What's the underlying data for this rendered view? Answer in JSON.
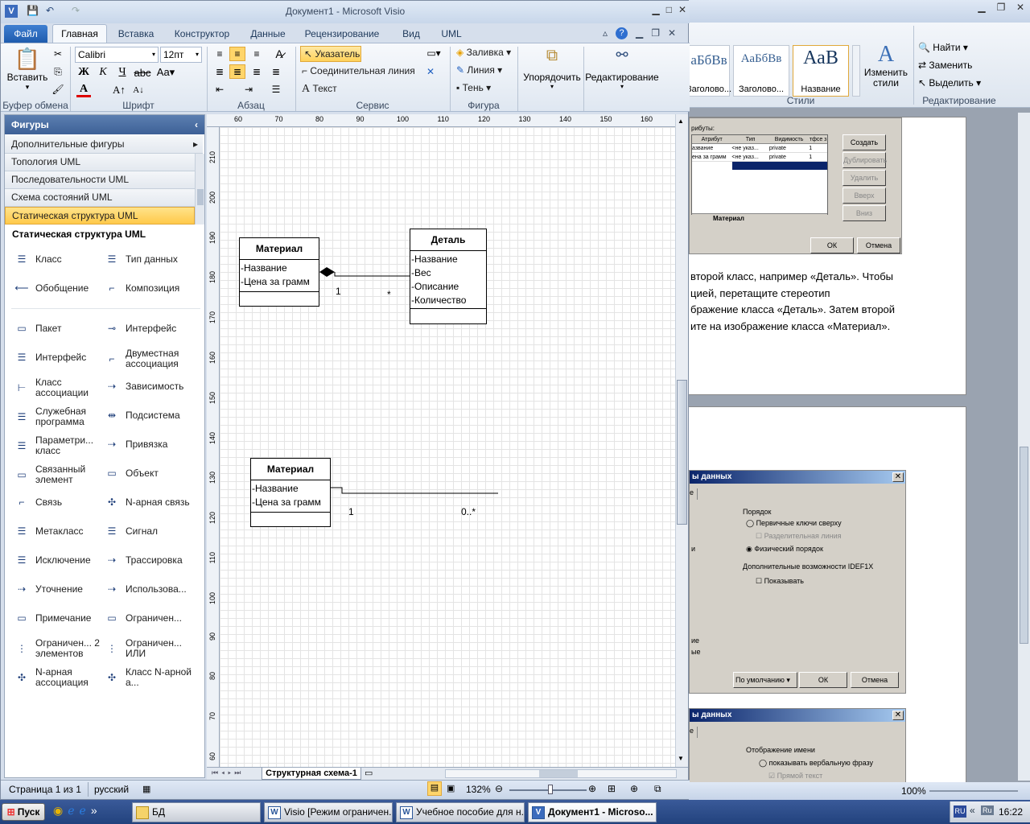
{
  "visio": {
    "title": "Документ1 - Microsoft Visio",
    "tabs": [
      "Файл",
      "Главная",
      "Вставка",
      "Конструктор",
      "Данные",
      "Рецензирование",
      "Вид",
      "UML"
    ],
    "ribbon": {
      "paste": "Вставить",
      "clipboard": "Буфер обмена",
      "font_name": "Calibri",
      "font_size": "12пт",
      "font_group": "Шрифт",
      "paragraph_group": "Абзац",
      "pointer": "Указатель",
      "connector": "Соединительная линия",
      "text": "Текст",
      "service_group": "Сервис",
      "fill": "Заливка",
      "line": "Линия",
      "shadow": "Тень",
      "shape_group": "Фигура",
      "arrange": "Упорядочить",
      "editing": "Редактирование"
    },
    "shapes": {
      "header": "Фигуры",
      "stencils": [
        "Дополнительные фигуры",
        "Топология UML",
        "Последовательности UML",
        "Схема состояний UML",
        "Статическая структура UML"
      ],
      "section_title": "Статическая структура UML",
      "items": [
        [
          "Класс",
          "Тип данных"
        ],
        [
          "Обобщение",
          "Композиция"
        ],
        [
          "Пакет",
          "Интерфейс"
        ],
        [
          "Интерфейс",
          "Двуместная ассоциация"
        ],
        [
          "Класс ассоциации",
          "Зависимость"
        ],
        [
          "Служебная программа",
          "Подсистема"
        ],
        [
          "Параметри... класс",
          "Привязка"
        ],
        [
          "Связанный элемент",
          "Объект"
        ],
        [
          "Связь",
          "N-арная связь"
        ],
        [
          "Метакласс",
          "Сигнал"
        ],
        [
          "Исключение",
          "Трассировка"
        ],
        [
          "Уточнение",
          "Использова..."
        ],
        [
          "Примечание",
          "Ограничен..."
        ],
        [
          "Ограничен... 2 элементов",
          "Ограничен... ИЛИ"
        ],
        [
          "N-арная ассоциация",
          "Класс N-арной а..."
        ]
      ]
    },
    "ruler_h": [
      "60",
      "70",
      "80",
      "90",
      "100",
      "110",
      "120",
      "130",
      "140",
      "150",
      "160"
    ],
    "ruler_v": [
      "210",
      "200",
      "190",
      "180",
      "170",
      "160",
      "150",
      "140",
      "130",
      "120",
      "110",
      "100",
      "90",
      "80",
      "70",
      "60"
    ],
    "diagram": {
      "class1": {
        "name": "Материал",
        "attrs": [
          "-Название",
          "-Цена за грамм"
        ]
      },
      "class2": {
        "name": "Деталь",
        "attrs": [
          "-Название",
          "-Вес",
          "-Описание",
          "-Количество"
        ]
      },
      "mult1": "1",
      "mult2": "*",
      "class3": {
        "name": "Материал",
        "attrs": [
          "-Название",
          "-Цена за грамм"
        ]
      },
      "mult3": "1",
      "mult4": "0..*"
    },
    "page_tab": "Структурная схема-1",
    "status": {
      "page": "Страница 1 из 1",
      "lang": "русский",
      "zoom": "132%"
    }
  },
  "word": {
    "styles": [
      {
        "preview": "аБбВв",
        "label": "Заголово..."
      },
      {
        "preview": "АаБбВв",
        "label": "Заголово..."
      },
      {
        "preview": "АаВ",
        "label": "Название"
      }
    ],
    "change_styles": "Изменить стили",
    "styles_group": "Стили",
    "find": "Найти",
    "replace": "Заменить",
    "select": "Выделить",
    "editing_group": "Редактирование",
    "attr_dialog": {
      "label": "рибуты:",
      "cols": [
        "Атрибут",
        "Тип",
        "Видимость",
        "тфсе з"
      ],
      "rows": [
        [
          "азвание",
          "<не указ...",
          "private",
          "1"
        ],
        [
          "ена за грамм",
          "<не указ...",
          "private",
          "1"
        ]
      ],
      "buttons": [
        "Создать",
        "Дублировать",
        "Удалить",
        "Вверх",
        "Вниз"
      ],
      "tab": "Материал",
      "ok": "ОК",
      "cancel": "Отмена"
    },
    "paragraph": [
      "второй класс, например «Деталь». Чтобы",
      "цией, перетащите стереотип",
      "бражение класса «Деталь». Затем второй",
      "ите на изображение класса «Материал»."
    ],
    "dialog2": {
      "title": "ы данных",
      "tab": "е",
      "order": "Порядок",
      "opt1": "Первичные ключи сверху",
      "opt1_sub": "Разделительная линия",
      "left1": "и",
      "opt2": "Физический порядок",
      "idef": "Дополнительные возможности IDEF1X",
      "show": "Показывать",
      "left2": "ие",
      "left3": "ые",
      "default_btn": "По умолчанию",
      "ok": "ОК",
      "cancel": "Отмена"
    },
    "dialog3": {
      "title": "ы данных",
      "tab": "е",
      "name_display": "Отображение имени",
      "opt": "показывать вербальную фразу",
      "opt_sub": "Прямой текст"
    },
    "zoom": "100%"
  },
  "taskbar": {
    "start": "Пуск",
    "items": [
      "БД",
      "Visio [Режим ограничен...",
      "Учебное пособие для н...",
      "Документ1 - Microso..."
    ],
    "lang": "RU",
    "time": "16:22"
  }
}
